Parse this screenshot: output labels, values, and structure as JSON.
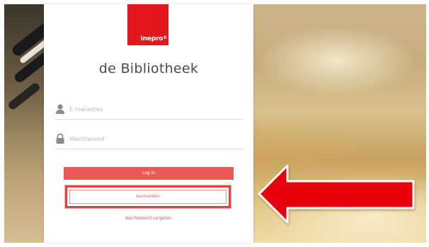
{
  "brand": {
    "logo_text": "inepro",
    "logo_mark": "®",
    "accent_color": "#e3171c"
  },
  "login": {
    "title": "de Bibliotheek",
    "email_placeholder": "E-mailadres",
    "email_value": "",
    "password_placeholder": "Wachtwoord",
    "password_value": "",
    "login_button": "Log in",
    "register_button": "Aanmelden",
    "forgot_link": "Wachtwoord vergeten"
  },
  "icons": {
    "user": "user-icon",
    "lock": "lock-icon",
    "arrow": "arrow-left-icon"
  },
  "annotation": {
    "arrow_color": "#e8000b"
  }
}
